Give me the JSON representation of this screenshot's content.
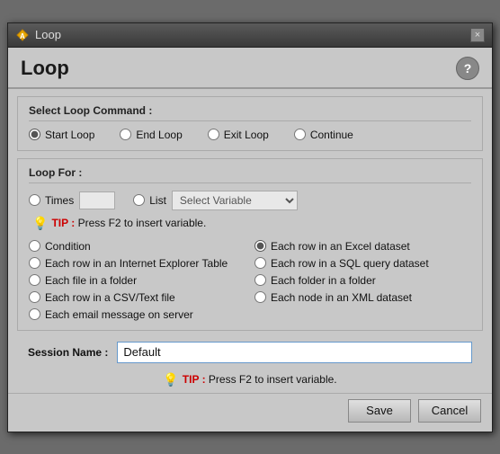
{
  "window": {
    "title": "Loop",
    "close_label": "×"
  },
  "header": {
    "title": "Loop",
    "help_label": "?"
  },
  "loop_command": {
    "section_label": "Select Loop Command :",
    "options": [
      {
        "id": "start_loop",
        "label": "Start Loop",
        "checked": true
      },
      {
        "id": "end_loop",
        "label": "End Loop",
        "checked": false
      },
      {
        "id": "exit_loop",
        "label": "Exit Loop",
        "checked": false
      },
      {
        "id": "continue",
        "label": "Continue",
        "checked": false
      }
    ]
  },
  "loop_for": {
    "section_label": "Loop For :",
    "times_label": "Times",
    "times_value": "",
    "tip_label": "TIP :",
    "tip_text": "Press F2 to insert variable.",
    "list_label": "List",
    "list_placeholder": "Select Variable",
    "options_left": [
      {
        "id": "condition",
        "label": "Condition",
        "checked": false
      },
      {
        "id": "ie_table",
        "label": "Each row in an Internet Explorer Table",
        "checked": false
      },
      {
        "id": "folder_files",
        "label": "Each file in a folder",
        "checked": false
      },
      {
        "id": "csv_file",
        "label": "Each row in a CSV/Text file",
        "checked": false
      },
      {
        "id": "email_server",
        "label": "Each email message on server",
        "checked": false
      }
    ],
    "options_right": [
      {
        "id": "excel_dataset",
        "label": "Each row in an Excel dataset",
        "checked": true
      },
      {
        "id": "sql_dataset",
        "label": "Each row in a SQL query dataset",
        "checked": false
      },
      {
        "id": "folder_in_folder",
        "label": "Each folder in a folder",
        "checked": false
      },
      {
        "id": "xml_dataset",
        "label": "Each node in an XML dataset",
        "checked": false
      }
    ]
  },
  "session": {
    "label": "Session Name :",
    "value": "Default",
    "tip_label": "TIP :",
    "tip_text": "Press F2 to insert variable."
  },
  "footer": {
    "save_label": "Save",
    "cancel_label": "Cancel"
  }
}
